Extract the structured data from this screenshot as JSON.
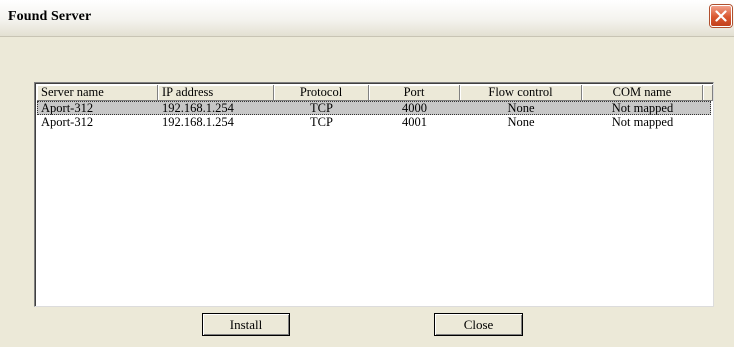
{
  "window": {
    "title": "Found Server"
  },
  "table": {
    "columns": [
      "Server name",
      "IP address",
      "Protocol",
      "Port",
      "Flow control",
      "COM name"
    ],
    "rows": [
      [
        "Aport-312",
        "192.168.1.254",
        "TCP",
        "4000",
        "None",
        "Not mapped"
      ],
      [
        "Aport-312",
        "192.168.1.254",
        "TCP",
        "4001",
        "None",
        "Not mapped"
      ]
    ],
    "selected_row": 0
  },
  "buttons": {
    "install": "Install",
    "close": "Close"
  },
  "colors": {
    "selection": "#c7c7c7",
    "dialog_bg": "#ece9d8",
    "close_button": "#d9572f"
  }
}
